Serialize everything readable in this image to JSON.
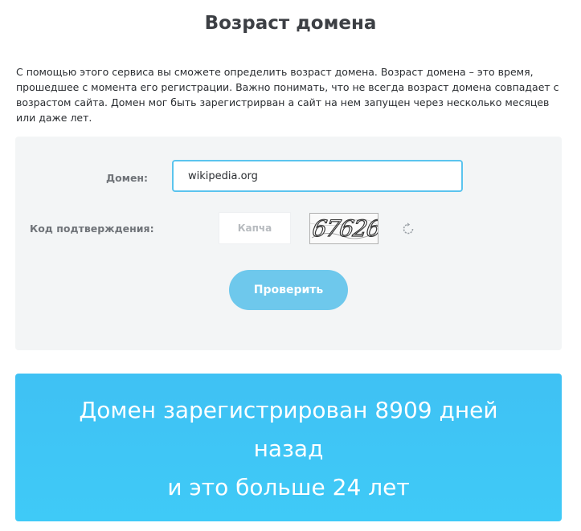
{
  "page": {
    "title": "Возраст домена",
    "intro": "С помощью этого сервиса вы сможете определить возраст домена. Возраст домена – это время, прошедшее с момента его регистрации. Важно понимать, что не всегда возраст домена совпадает с возрастом сайта. Домен мог быть зарегистрирван а сайт на нем запущен через несколько месяцев или даже лет."
  },
  "form": {
    "domain_label": "Домен:",
    "domain_value": "wikipedia.org",
    "captcha_label": "Код подтверждения:",
    "captcha_placeholder": "Капча",
    "captcha_image_text": "67626",
    "refresh_icon": "refresh-icon",
    "submit_label": "Проверить"
  },
  "result": {
    "line1": "Домен зарегистрирован 8909 дней",
    "line2": "назад",
    "line3": "и это больше 24 лет"
  },
  "colors": {
    "accent": "#5bc4ee",
    "button": "#6ec8ec",
    "result_background": "#3fc4f5",
    "panel_background": "#f3f5f6"
  }
}
